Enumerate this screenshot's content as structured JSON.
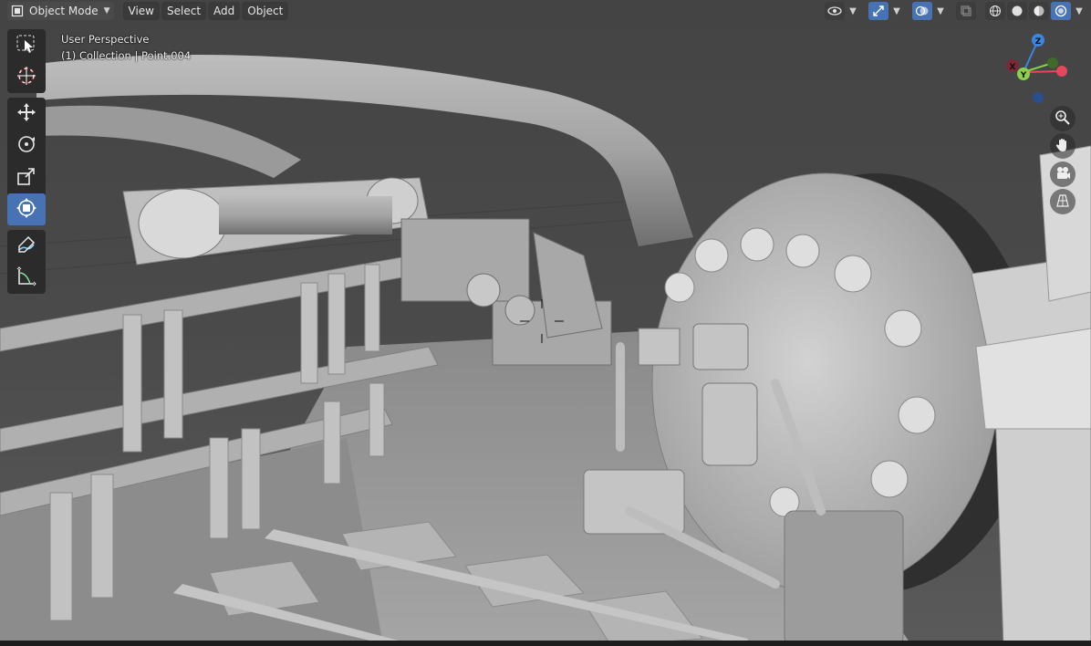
{
  "header": {
    "mode_label": "Object Mode",
    "menus": [
      "View",
      "Select",
      "Add",
      "Object"
    ]
  },
  "overlay": {
    "perspective": "User Perspective",
    "collection_info": "(1) Collection | Point.004"
  },
  "gizmo": {
    "z_label": "Z",
    "y_label": "Y",
    "x_label": "X"
  },
  "colors": {
    "accent": "#4772b3",
    "axis_x": "#e5475c",
    "axis_y": "#8bd14e",
    "axis_z": "#3b87e0",
    "header_bg": "#3d3d3d"
  },
  "icons": {
    "toolbar": [
      "select-box-icon",
      "cursor-icon",
      "move-icon",
      "rotate-icon",
      "scale-icon",
      "transform-icon",
      "annotate-icon",
      "measure-icon"
    ],
    "navigation": [
      "zoom-icon",
      "pan-hand-icon",
      "camera-view-icon",
      "orthographic-grid-icon"
    ],
    "header_right": [
      "visibility-icon",
      "gizmo-toggle-icon",
      "overlay-icon",
      "xray-icon",
      "wireframe-shading-icon",
      "solid-shading-icon",
      "material-shading-icon",
      "rendered-shading-icon"
    ]
  }
}
